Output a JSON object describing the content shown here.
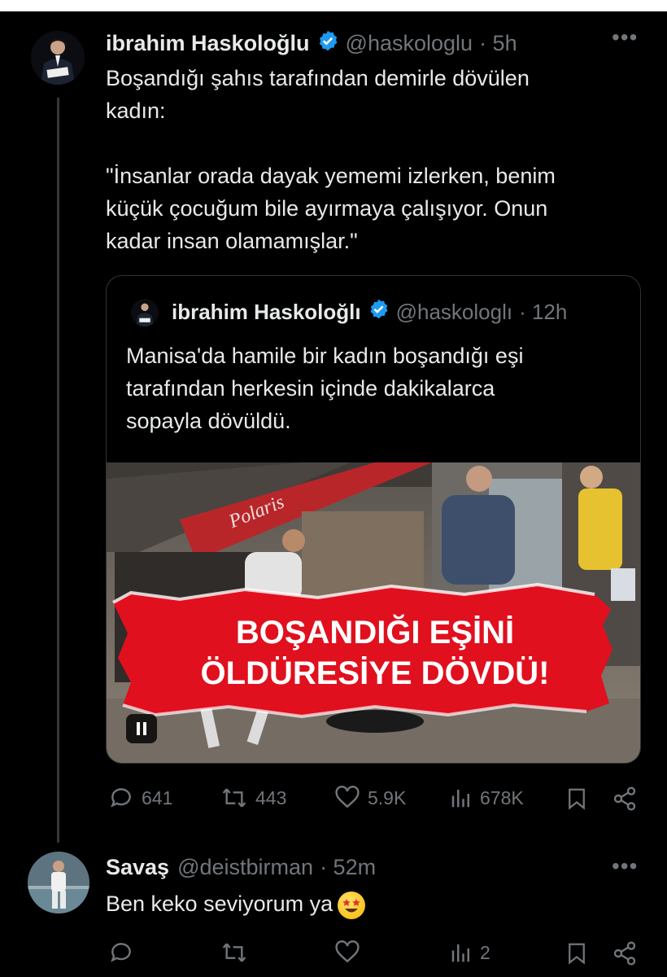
{
  "main_tweet": {
    "name": "ibrahim Haskoloğlu",
    "handle": "@haskologlu",
    "time": "· 5h",
    "text": "Boşandığı şahıs tarafından demirle dövülen\nkadın:\n\n\"İnsanlar orada dayak yememi izlerken, benim\nküçük çocuğum bile ayırmaya çalışıyor. Onun\nkadar insan olamamışlar.\""
  },
  "quoted_tweet": {
    "name": "ibrahim Haskoloğlı",
    "handle": "@haskologlı",
    "time": "· 12h",
    "text": "Manisa'da hamile bir kadın boşandığı eşi\ntarafından herkesin içinde dakikalarca\nsopayla dövüldü.",
    "video_banner_line1": "BOŞANDIĞI EŞİNİ",
    "video_banner_line2": "ÖLDÜRESİYE DÖVDÜ!",
    "store_sign": "Polaris"
  },
  "main_actions": {
    "replies": "641",
    "retweets": "443",
    "likes": "5.9K",
    "views": "678K"
  },
  "reply_tweet": {
    "name": "Savaş",
    "handle": "@deistbirman",
    "time": "· 52m",
    "text": "Ben keko seviyorum ya"
  },
  "reply_actions": {
    "replies": "",
    "retweets": "",
    "likes": "",
    "views": "2"
  },
  "colors": {
    "background": "#000000",
    "text": "#e7e9ea",
    "muted": "#71767b",
    "verified": "#1d9bf0",
    "border": "#2f3336",
    "banner_red": "#e0101e"
  },
  "icons": [
    "verified-badge-icon",
    "more-icon",
    "reply-icon",
    "retweet-icon",
    "like-icon",
    "views-icon",
    "bookmark-icon",
    "share-icon",
    "pause-icon",
    "star-struck-emoji"
  ]
}
